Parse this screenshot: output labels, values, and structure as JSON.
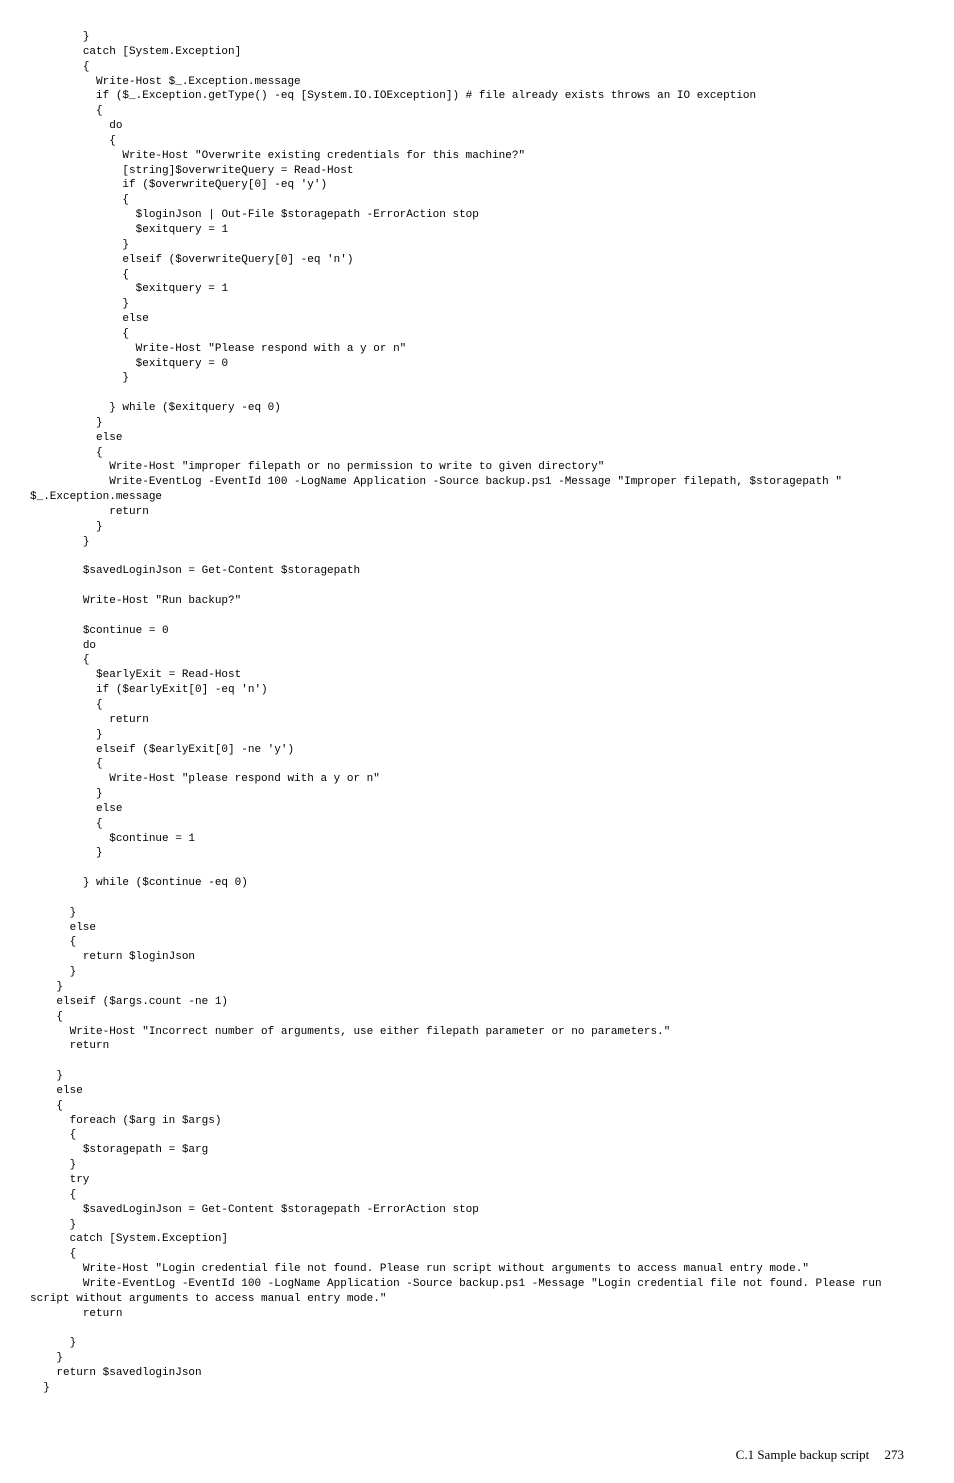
{
  "code": "        }\n        catch [System.Exception]\n        {\n          Write-Host $_.Exception.message\n          if ($_.Exception.getType() -eq [System.IO.IOException]) # file already exists throws an IO exception\n          {\n            do\n            {\n              Write-Host \"Overwrite existing credentials for this machine?\"\n              [string]$overwriteQuery = Read-Host\n              if ($overwriteQuery[0] -eq 'y')\n              {\n                $loginJson | Out-File $storagepath -ErrorAction stop\n                $exitquery = 1\n              }\n              elseif ($overwriteQuery[0] -eq 'n')\n              {\n                $exitquery = 1\n              }\n              else\n              {\n                Write-Host \"Please respond with a y or n\"\n                $exitquery = 0\n              }\n\n            } while ($exitquery -eq 0)\n          }\n          else\n          {\n            Write-Host \"improper filepath or no permission to write to given directory\"\n            Write-EventLog -EventId 100 -LogName Application -Source backup.ps1 -Message \"Improper filepath, $storagepath \" $_.Exception.message\n            return\n          }\n        }\n\n        $savedLoginJson = Get-Content $storagepath\n\n        Write-Host \"Run backup?\"\n\n        $continue = 0\n        do\n        {\n          $earlyExit = Read-Host\n          if ($earlyExit[0] -eq 'n')\n          {\n            return\n          }\n          elseif ($earlyExit[0] -ne 'y')\n          {\n            Write-Host \"please respond with a y or n\"\n          }\n          else\n          {\n            $continue = 1\n          }\n\n        } while ($continue -eq 0)\n\n      }\n      else\n      {\n        return $loginJson\n      }\n    }\n    elseif ($args.count -ne 1)\n    {\n      Write-Host \"Incorrect number of arguments, use either filepath parameter or no parameters.\"\n      return\n\n    }\n    else\n    {\n      foreach ($arg in $args)\n      {\n        $storagepath = $arg\n      }\n      try\n      {\n        $savedLoginJson = Get-Content $storagepath -ErrorAction stop\n      }\n      catch [System.Exception]\n      {\n        Write-Host \"Login credential file not found. Please run script without arguments to access manual entry mode.\"\n        Write-EventLog -EventId 100 -LogName Application -Source backup.ps1 -Message \"Login credential file not found. Please run script without arguments to access manual entry mode.\"\n        return\n\n      }\n    }\n    return $savedloginJson\n  }",
  "footer": {
    "section": "C.1 Sample backup script",
    "page": "273"
  }
}
